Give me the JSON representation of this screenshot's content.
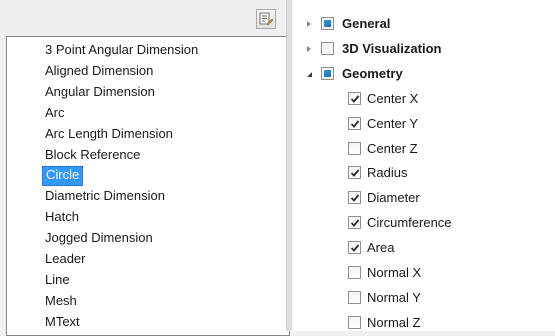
{
  "object_types": {
    "items": [
      "3 Point Angular Dimension",
      "Aligned Dimension",
      "Angular Dimension",
      "Arc",
      "Arc Length Dimension",
      "Block Reference",
      "Circle",
      "Diametric Dimension",
      "Hatch",
      "Jogged Dimension",
      "Leader",
      "Line",
      "Mesh",
      "MText"
    ],
    "selected": "Circle"
  },
  "properties": {
    "categories": [
      {
        "label": "General",
        "expanded": false,
        "state": "partial"
      },
      {
        "label": "3D Visualization",
        "expanded": false,
        "state": "unchecked"
      },
      {
        "label": "Geometry",
        "expanded": true,
        "state": "partial"
      }
    ],
    "geometry_items": [
      {
        "label": "Center X",
        "checked": true
      },
      {
        "label": "Center Y",
        "checked": true
      },
      {
        "label": "Center Z",
        "checked": false
      },
      {
        "label": "Radius",
        "checked": true
      },
      {
        "label": "Diameter",
        "checked": true
      },
      {
        "label": "Circumference",
        "checked": true
      },
      {
        "label": "Area",
        "checked": true
      },
      {
        "label": "Normal X",
        "checked": false
      },
      {
        "label": "Normal Y",
        "checked": false
      },
      {
        "label": "Normal Z",
        "checked": false
      }
    ]
  },
  "colors": {
    "selection": "#3399ff",
    "category_fill": "#1f6fa8"
  },
  "icons": {
    "toolbar": "edit-list-icon"
  }
}
